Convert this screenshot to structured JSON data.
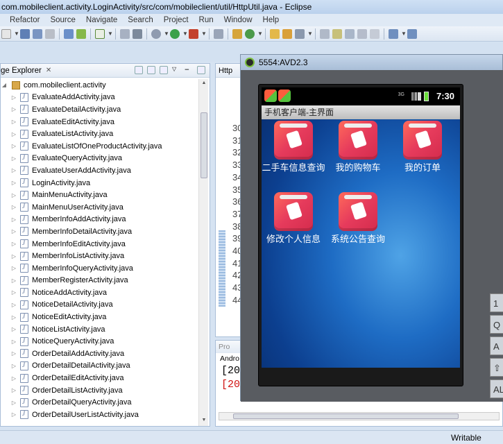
{
  "window": {
    "title": "com.mobileclient.activity.LoginActivity/src/com/mobileclient/util/HttpUtil.java - Eclipse"
  },
  "menu": [
    "Refactor",
    "Source",
    "Navigate",
    "Search",
    "Project",
    "Run",
    "Window",
    "Help"
  ],
  "package_explorer": {
    "title": "ge Explorer",
    "package": "com.mobileclient.activity",
    "files": [
      "EvaluateAddActivity.java",
      "EvaluateDetailActivity.java",
      "EvaluateEditActivity.java",
      "EvaluateListActivity.java",
      "EvaluateListOfOneProductActivity.java",
      "EvaluateQueryActivity.java",
      "EvaluateUserAddActivity.java",
      "LoginActivity.java",
      "MainMenuActivity.java",
      "MainMenuUserActivity.java",
      "MemberInfoAddActivity.java",
      "MemberInfoDetailActivity.java",
      "MemberInfoEditActivity.java",
      "MemberInfoListActivity.java",
      "MemberInfoQueryActivity.java",
      "MemberRegisterActivity.java",
      "NoticeAddActivity.java",
      "NoticeDetailActivity.java",
      "NoticeEditActivity.java",
      "NoticeListActivity.java",
      "NoticeQueryActivity.java",
      "OrderDetailAddActivity.java",
      "OrderDetailDetailActivity.java",
      "OrderDetailEditActivity.java",
      "OrderDetailListActivity.java",
      "OrderDetailQueryActivity.java",
      "OrderDetailUserListActivity.java"
    ]
  },
  "editor": {
    "tab": "Http",
    "line_numbers": [
      "30",
      "31",
      "32",
      "33",
      "34",
      "35",
      "36",
      "37",
      "38",
      "39",
      "40",
      "41",
      "42",
      "43",
      "44"
    ]
  },
  "console": {
    "tab": "Pro",
    "source": "Andro",
    "lines": [
      {
        "text": "[20",
        "color": "#000000"
      },
      {
        "text": "[20",
        "color": "#d01010"
      }
    ]
  },
  "status": {
    "writable": "Writable"
  },
  "emulator": {
    "title": "5554:AVD2.3",
    "time": "7:30",
    "app_title": "手机客户端-主界面",
    "apps": [
      {
        "label": "二手车信息查询"
      },
      {
        "label": "我的购物车"
      },
      {
        "label": "我的订单"
      },
      {
        "label": "修改个人信息"
      },
      {
        "label": "系统公告查询"
      }
    ],
    "side_keys": [
      "1",
      "Q",
      "A",
      "⇧",
      "AL"
    ]
  }
}
